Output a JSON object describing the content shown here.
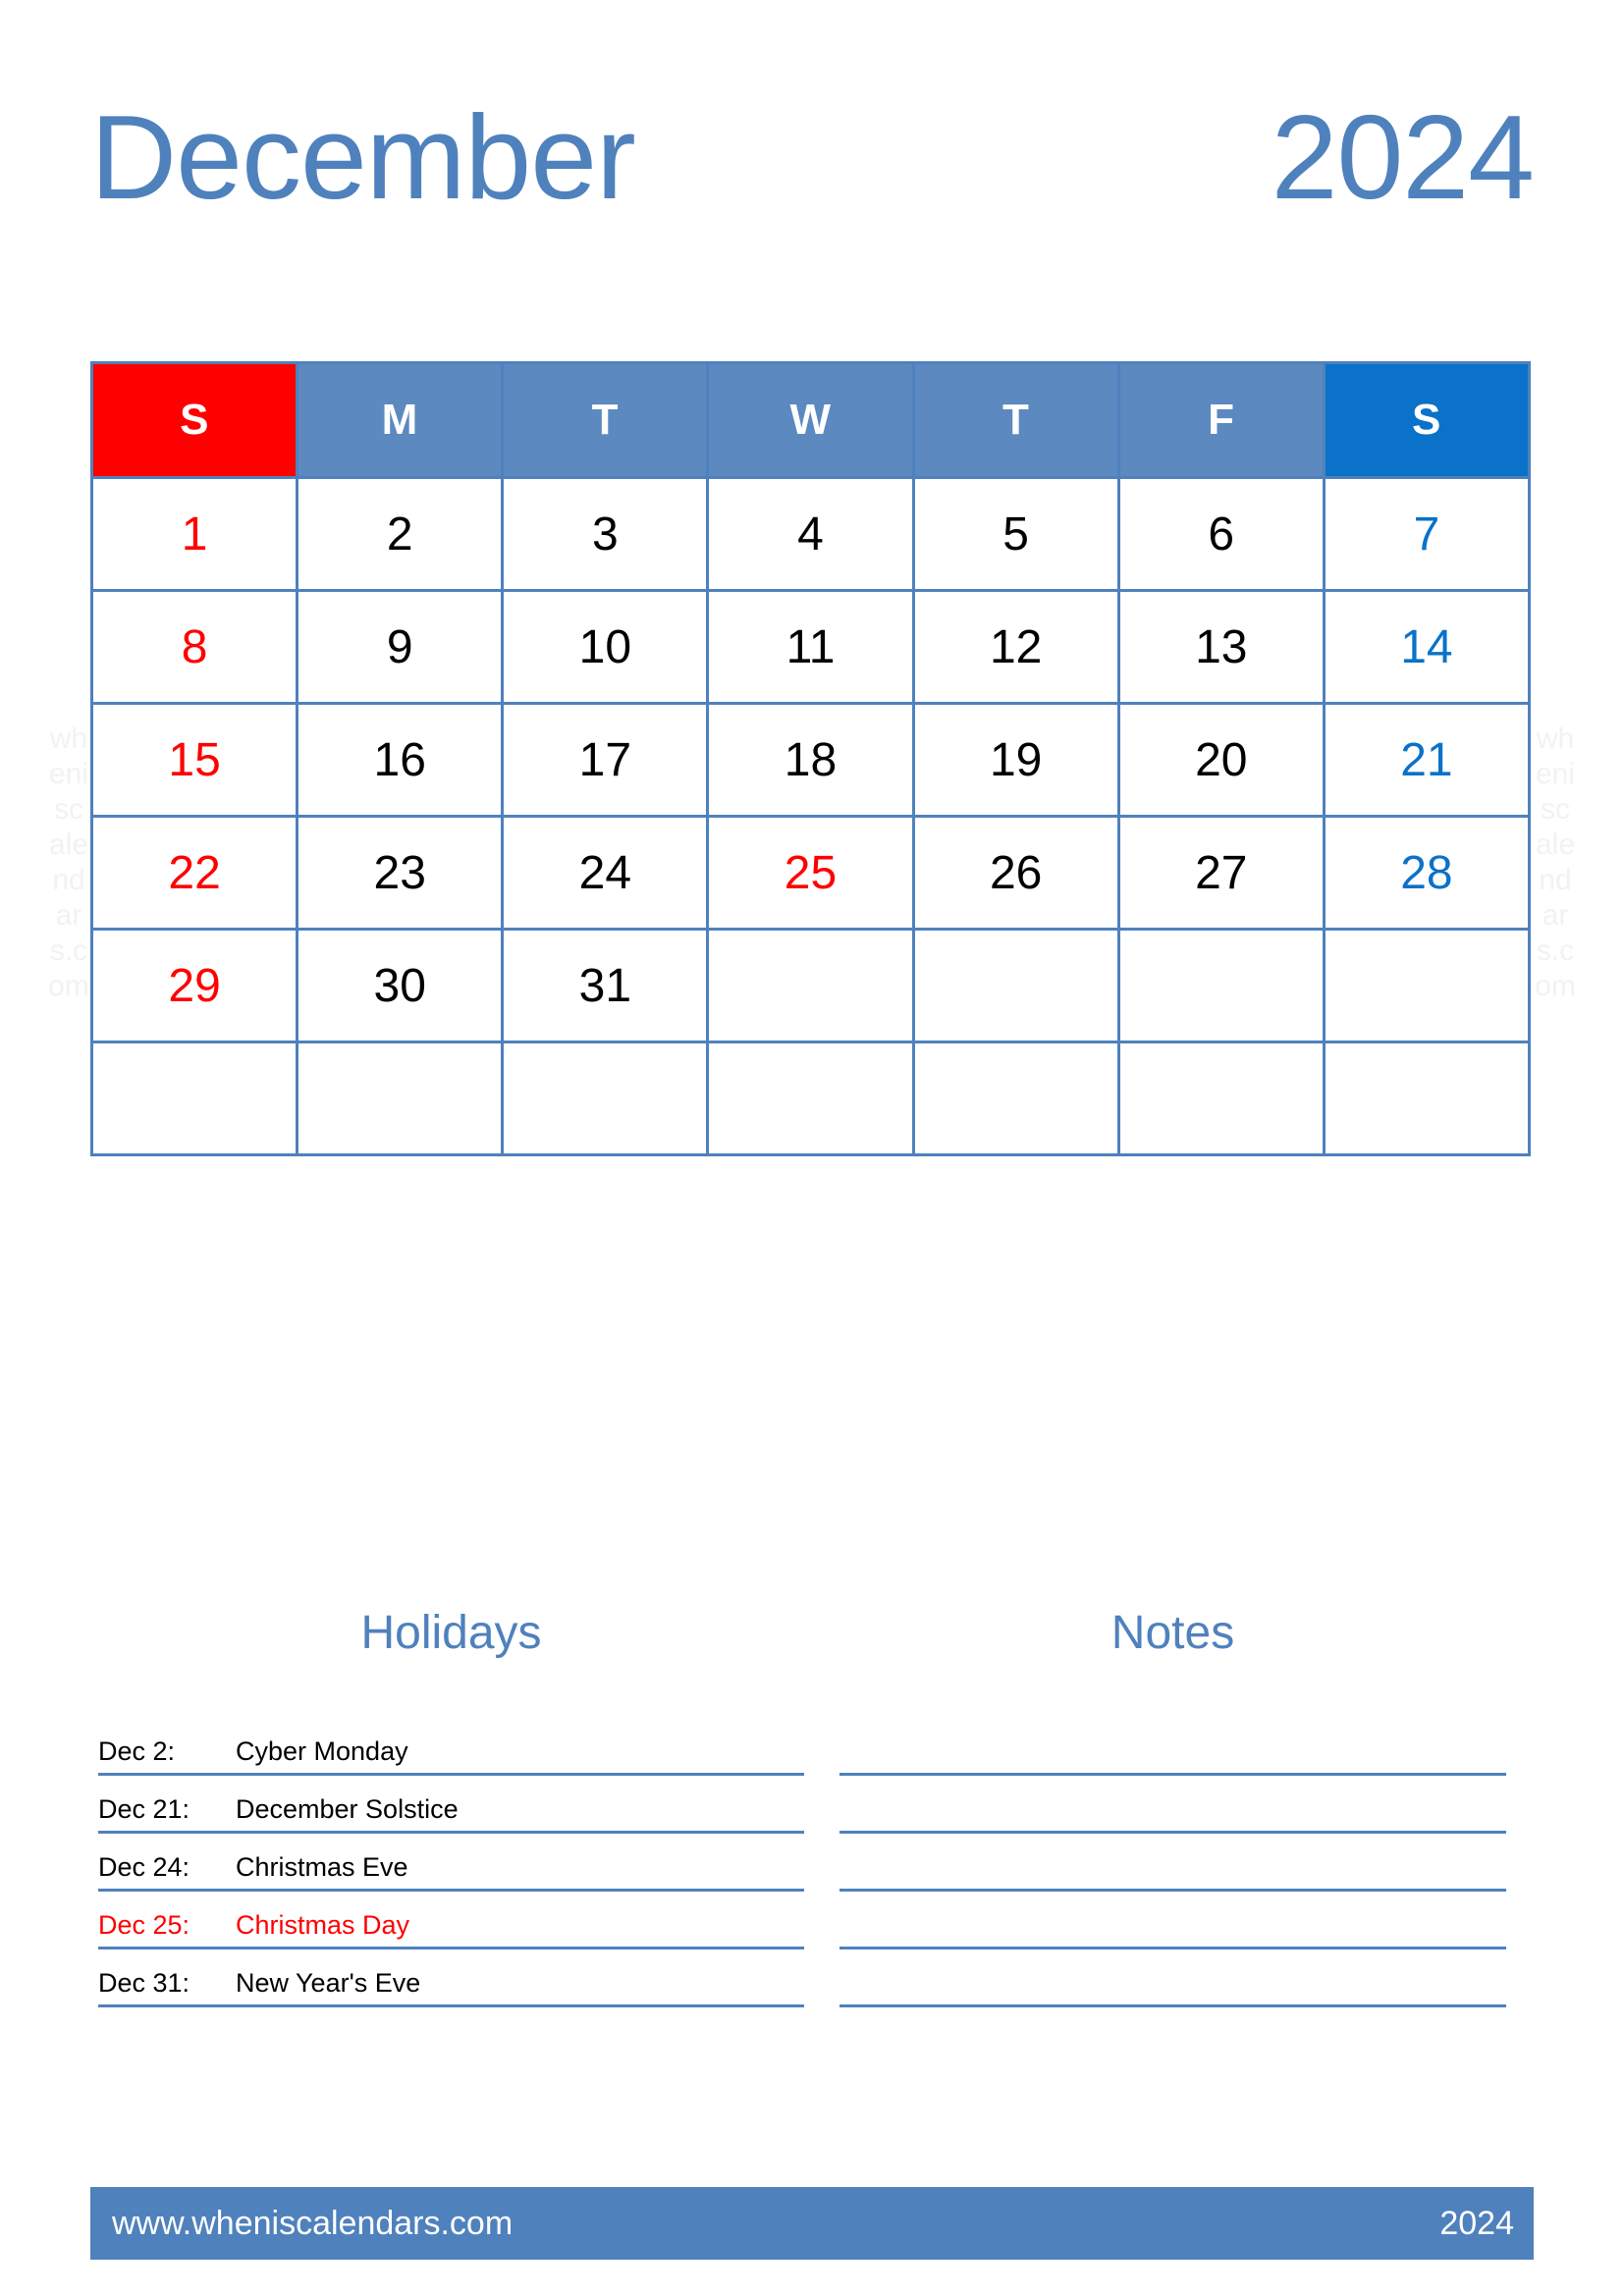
{
  "header": {
    "month": "December",
    "year": "2024"
  },
  "colors": {
    "accent_blue": "#4F81BD",
    "header_weekday_blue": "#5B89C0",
    "saturday_blue": "#0A72C8",
    "sunday_red": "#FF0000",
    "text_black": "#000000",
    "watermark_gray": "#F2F2F2",
    "page_background": "#FFFFFF"
  },
  "calendar": {
    "weekday_headers": [
      {
        "label": "S",
        "kind": "sunday"
      },
      {
        "label": "M",
        "kind": "weekday"
      },
      {
        "label": "T",
        "kind": "weekday"
      },
      {
        "label": "W",
        "kind": "weekday"
      },
      {
        "label": "T",
        "kind": "weekday"
      },
      {
        "label": "F",
        "kind": "weekday"
      },
      {
        "label": "S",
        "kind": "saturday"
      }
    ],
    "weeks": [
      [
        {
          "day": "1",
          "kind": "sunday"
        },
        {
          "day": "2",
          "kind": "weekday"
        },
        {
          "day": "3",
          "kind": "weekday"
        },
        {
          "day": "4",
          "kind": "weekday"
        },
        {
          "day": "5",
          "kind": "weekday"
        },
        {
          "day": "6",
          "kind": "weekday"
        },
        {
          "day": "7",
          "kind": "saturday"
        }
      ],
      [
        {
          "day": "8",
          "kind": "sunday"
        },
        {
          "day": "9",
          "kind": "weekday"
        },
        {
          "day": "10",
          "kind": "weekday"
        },
        {
          "day": "11",
          "kind": "weekday"
        },
        {
          "day": "12",
          "kind": "weekday"
        },
        {
          "day": "13",
          "kind": "weekday"
        },
        {
          "day": "14",
          "kind": "saturday"
        }
      ],
      [
        {
          "day": "15",
          "kind": "sunday"
        },
        {
          "day": "16",
          "kind": "weekday"
        },
        {
          "day": "17",
          "kind": "weekday"
        },
        {
          "day": "18",
          "kind": "weekday"
        },
        {
          "day": "19",
          "kind": "weekday"
        },
        {
          "day": "20",
          "kind": "weekday"
        },
        {
          "day": "21",
          "kind": "saturday"
        }
      ],
      [
        {
          "day": "22",
          "kind": "sunday"
        },
        {
          "day": "23",
          "kind": "weekday"
        },
        {
          "day": "24",
          "kind": "weekday"
        },
        {
          "day": "25",
          "kind": "holiday"
        },
        {
          "day": "26",
          "kind": "weekday"
        },
        {
          "day": "27",
          "kind": "weekday"
        },
        {
          "day": "28",
          "kind": "saturday"
        }
      ],
      [
        {
          "day": "29",
          "kind": "sunday"
        },
        {
          "day": "30",
          "kind": "weekday"
        },
        {
          "day": "31",
          "kind": "weekday"
        },
        {
          "day": "",
          "kind": "empty"
        },
        {
          "day": "",
          "kind": "empty"
        },
        {
          "day": "",
          "kind": "empty"
        },
        {
          "day": "",
          "kind": "empty"
        }
      ],
      [
        {
          "day": "",
          "kind": "empty"
        },
        {
          "day": "",
          "kind": "empty"
        },
        {
          "day": "",
          "kind": "empty"
        },
        {
          "day": "",
          "kind": "empty"
        },
        {
          "day": "",
          "kind": "empty"
        },
        {
          "day": "",
          "kind": "empty"
        },
        {
          "day": "",
          "kind": "empty"
        }
      ]
    ]
  },
  "holidays": {
    "title": "Holidays",
    "items": [
      {
        "date": "Dec 2:",
        "name": "Cyber Monday",
        "highlight": false
      },
      {
        "date": "Dec 21:",
        "name": "December Solstice",
        "highlight": false
      },
      {
        "date": "Dec 24:",
        "name": "Christmas Eve",
        "highlight": false
      },
      {
        "date": "Dec 25:",
        "name": "Christmas Day",
        "highlight": true
      },
      {
        "date": "Dec 31:",
        "name": "New Year's Eve",
        "highlight": false
      }
    ]
  },
  "notes": {
    "title": "Notes",
    "line_count": 5
  },
  "footer": {
    "website": "www.wheniscalendars.com",
    "year": "2024"
  },
  "watermark": {
    "text": "wheniscalendars.com"
  }
}
